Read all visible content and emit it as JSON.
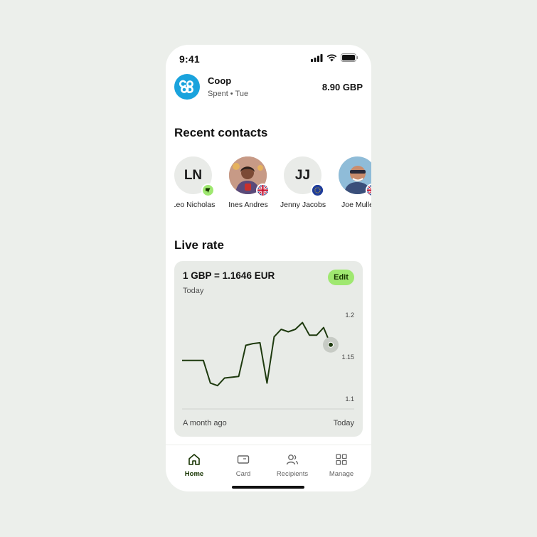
{
  "status_bar": {
    "time": "9:41"
  },
  "transaction": {
    "merchant": "Coop",
    "subtitle": "Spent • Tue",
    "amount": "8.90 GBP",
    "logo_icon": "coop-logo",
    "logo_color": "#1aa3dd"
  },
  "recent_contacts": {
    "title": "Recent contacts",
    "contacts": [
      {
        "initials": "LN",
        "name": "Leo Nicholas",
        "badge": "wise-badge-icon"
      },
      {
        "initials": "",
        "name": "Ines Andres",
        "badge": "uk-flag-icon"
      },
      {
        "initials": "JJ",
        "name": "Jenny Jacobs",
        "badge": "eu-flag-icon"
      },
      {
        "initials": "",
        "name": "Joe Mulle",
        "badge": "uk-flag-icon"
      }
    ]
  },
  "live_rate": {
    "title": "Live rate",
    "rate_text": "1 GBP = 1.1646 EUR",
    "subtitle": "Today",
    "edit_label": "Edit",
    "x_start_label": "A month ago",
    "x_end_label": "Today"
  },
  "chart_data": {
    "type": "line",
    "title": "",
    "xlabel": "",
    "ylabel": "",
    "x_tick_labels": [
      "A month ago",
      "Today"
    ],
    "y_ticks": [
      "1.2",
      "1.15",
      "1.1"
    ],
    "ylim": [
      1.095,
      1.205
    ],
    "series": [
      {
        "values": [
          1.146,
          1.146,
          1.146,
          1.146,
          1.119,
          1.116,
          1.125,
          1.126,
          1.127,
          1.164,
          1.166,
          1.167,
          1.119,
          1.174,
          1.183,
          1.18,
          1.183,
          1.191,
          1.176,
          1.176,
          1.185,
          1.1646
        ],
        "color": "#1e3a0f"
      }
    ],
    "last_point_highlight": true,
    "grid": false
  },
  "tab_bar": {
    "tabs": [
      {
        "label": "Home",
        "icon": "home-icon",
        "active": true
      },
      {
        "label": "Card",
        "icon": "card-icon",
        "active": false
      },
      {
        "label": "Recipients",
        "icon": "recipients-icon",
        "active": false
      },
      {
        "label": "Manage",
        "icon": "manage-grid-icon",
        "active": false
      }
    ]
  },
  "colors": {
    "accent": "#9fe870",
    "accent_text": "#163300",
    "card_bg": "#e8ebe7",
    "page_bg": "#ecefeb"
  }
}
